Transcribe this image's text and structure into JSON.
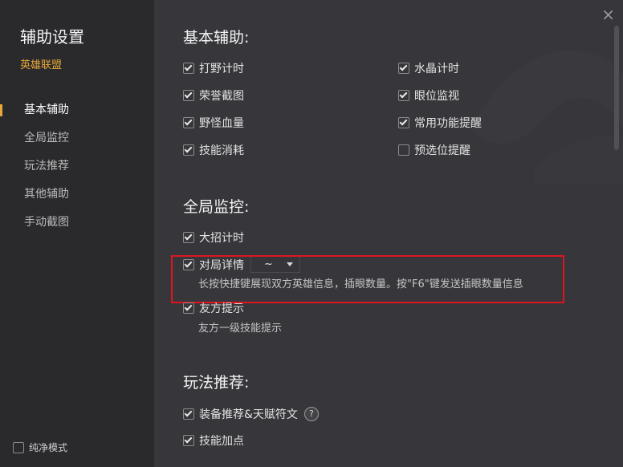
{
  "sidebar": {
    "title": "辅助设置",
    "subtitle": "英雄联盟",
    "items": [
      {
        "label": "基本辅助",
        "active": true
      },
      {
        "label": "全局监控",
        "active": false
      },
      {
        "label": "玩法推荐",
        "active": false
      },
      {
        "label": "其他辅助",
        "active": false
      },
      {
        "label": "手动截图",
        "active": false
      }
    ],
    "pure_mode": {
      "label": "纯净模式",
      "checked": false
    }
  },
  "window": {
    "close_glyph": "×"
  },
  "basic": {
    "title": "基本辅助:",
    "options": [
      {
        "label": "打野计时",
        "checked": true
      },
      {
        "label": "荣誉截图",
        "checked": true
      },
      {
        "label": "野怪血量",
        "checked": true
      },
      {
        "label": "技能消耗",
        "checked": true
      },
      {
        "label": "水晶计时",
        "checked": true
      },
      {
        "label": "眼位监视",
        "checked": true
      },
      {
        "label": "常用功能提醒",
        "checked": true
      },
      {
        "label": "预选位提醒",
        "checked": false
      }
    ]
  },
  "monitor": {
    "title": "全局监控:",
    "ult_timer": {
      "label": "大招计时",
      "checked": true
    },
    "match_detail": {
      "label": "对局详情",
      "checked": true,
      "hotkey": "~",
      "desc": "长按快捷键展现双方英雄信息，插眼数量。按\"F6\"键发送插眼数量信息"
    },
    "ally_hint": {
      "label": "友方提示",
      "checked": true,
      "desc": "友方一级技能提示"
    }
  },
  "recommend": {
    "title": "玩法推荐:",
    "gear": {
      "label": "装备推荐&天赋符文",
      "checked": true,
      "help": "?"
    },
    "skill": {
      "label": "技能加点",
      "checked": true
    }
  },
  "colors": {
    "accent": "#e8a93a",
    "highlight": "#e0141e",
    "sidebar_bg": "#2a2a2d",
    "main_bg": "#37373b"
  }
}
